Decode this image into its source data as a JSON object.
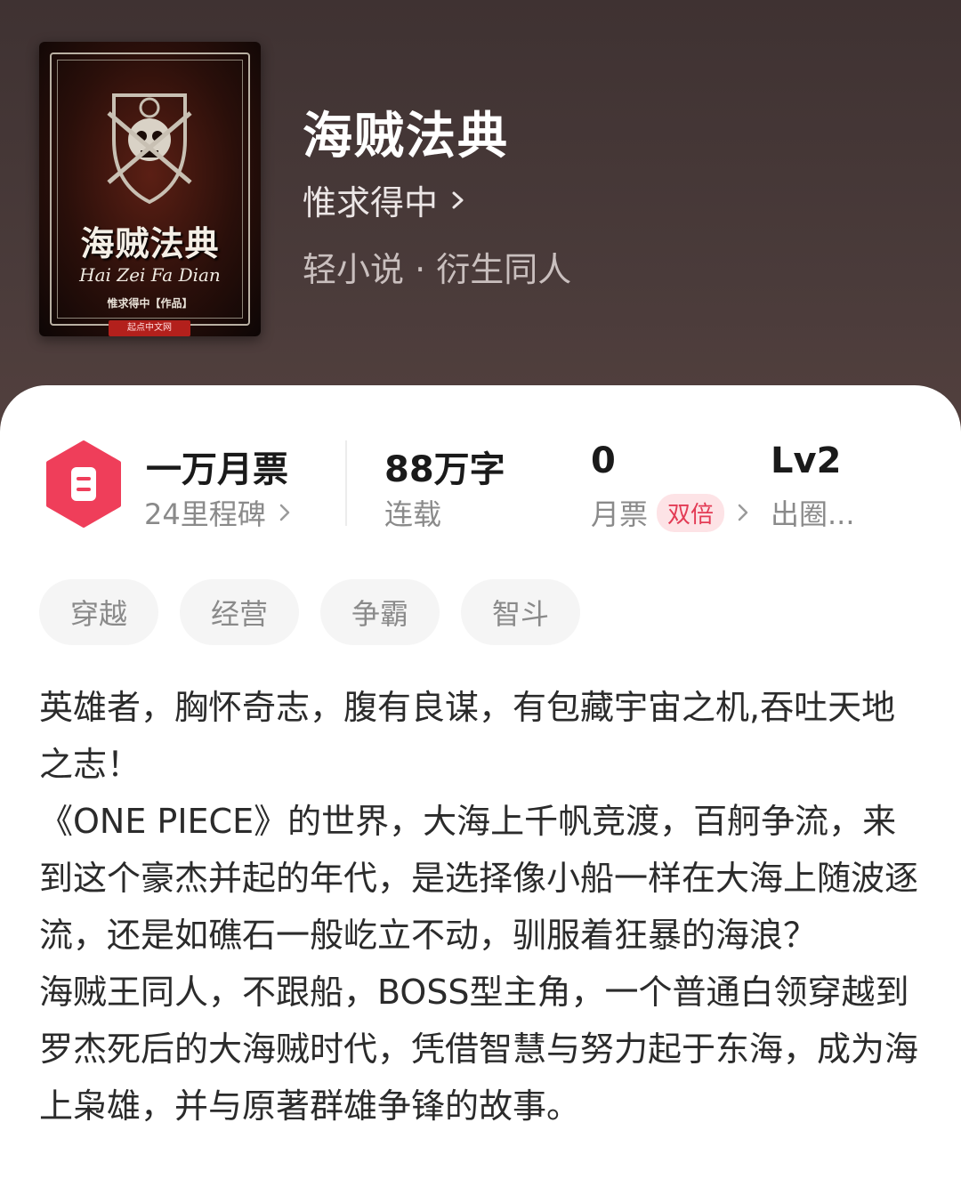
{
  "book": {
    "title": "海贼法典",
    "author": "惟求得中",
    "category": "轻小说 · 衍生同人",
    "cover": {
      "title": "海贼法典",
      "pinyin": "Hai Zei Fa Dian",
      "author_line": "惟求得中【作品】",
      "brand": "起点中文网"
    }
  },
  "stats": {
    "ticket": {
      "main": "一万月票",
      "sub": "24里程碑",
      "icon": "ticket-icon",
      "color": "#ef3e5a"
    },
    "words": {
      "main": "88万字",
      "sub": "连载"
    },
    "monthly": {
      "main": "0",
      "sub": "月票",
      "badge": "双倍"
    },
    "level": {
      "main": "Lv2",
      "sub": "出圈..."
    }
  },
  "tags": [
    "穿越",
    "经营",
    "争霸",
    "智斗"
  ],
  "description": [
    "英雄者，胸怀奇志，腹有良谋，有包藏宇宙之机,吞吐天地之志！",
    "《ONE PIECE》的世界，大海上千帆竞渡，百舸争流，来到这个豪杰并起的年代，是选择像小船一样在大海上随波逐流，还是如礁石一般屹立不动，驯服着狂暴的海浪？",
    "海贼王同人，不跟船，BOSS型主角，一个普通白领穿越到罗杰死后的大海贼时代，凭借智慧与努力起于东海，成为海上枭雄，并与原著群雄争锋的故事。"
  ],
  "colors": {
    "header_bg": "#4a3b3a",
    "accent": "#ef3e5a",
    "badge_bg": "#fde3e6"
  }
}
